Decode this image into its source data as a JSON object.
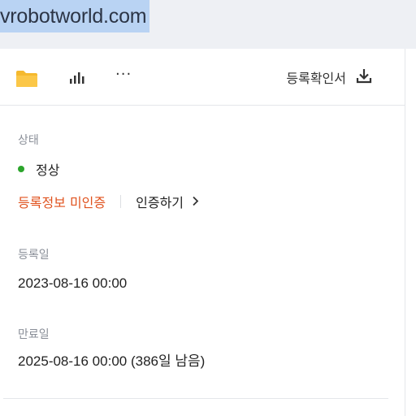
{
  "address_bar": {
    "domain": "vrobotworld.com"
  },
  "toolbar": {
    "folder_icon": "folder-icon",
    "stats_icon": "bar-chart-icon",
    "more_label": "···",
    "download_label": "등록확인서",
    "download_icon": "download-icon",
    "folder_color": "#f5b92e"
  },
  "status": {
    "label": "상태",
    "value": "정상",
    "dot_color": "#2ca52c",
    "unverified_label": "등록정보 미인증",
    "verify_link": "인증하기",
    "unverified_color": "#e0531f"
  },
  "registered": {
    "label": "등록일",
    "value": "2023-08-16 00:00"
  },
  "expiry": {
    "label": "만료일",
    "value": "2025-08-16 00:00 (386일 남음)"
  }
}
